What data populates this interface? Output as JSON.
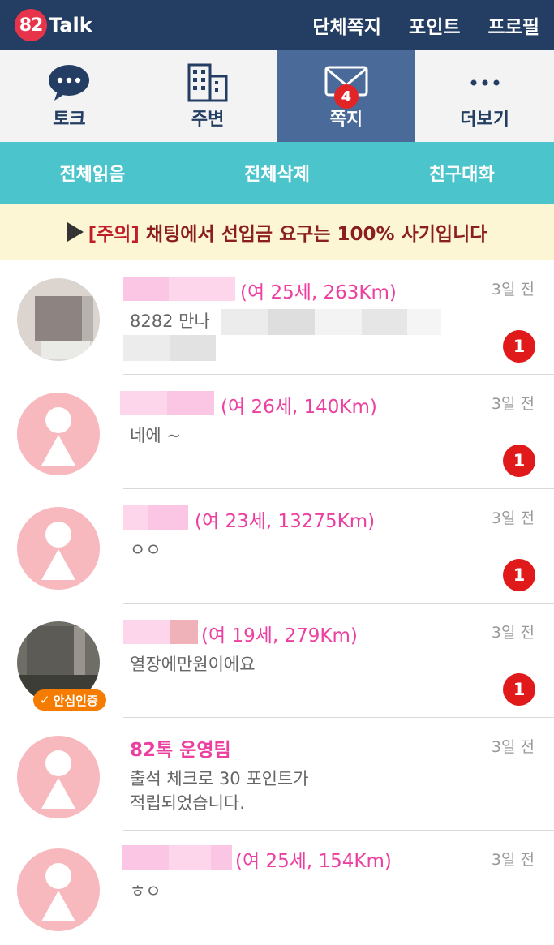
{
  "header": {
    "logo_number": "82",
    "logo_word": "Talk",
    "nav": [
      "단체쪽지",
      "포인트",
      "프로필"
    ]
  },
  "tabs": [
    {
      "label": "토크",
      "icon": "chat-bubble-icon",
      "active": false
    },
    {
      "label": "주변",
      "icon": "building-icon",
      "active": false
    },
    {
      "label": "쪽지",
      "icon": "envelope-icon",
      "active": true,
      "badge": "4"
    },
    {
      "label": "더보기",
      "icon": "more-dots-icon",
      "active": false
    }
  ],
  "actions": [
    "전체읽음",
    "전체삭제",
    "친구대화"
  ],
  "notice": {
    "warn": "[주의]",
    "text": " 채팅에서 선입금 요구는 100% 사기입니다"
  },
  "conversations": [
    {
      "info": "(여 25세, 263Km)",
      "message": "8282 만나",
      "time": "3일 전",
      "unread": "1",
      "avatar": "photo"
    },
    {
      "info": "(여 26세, 140Km)",
      "message": "네에 ~",
      "time": "3일 전",
      "unread": "1",
      "avatar": "default"
    },
    {
      "info": "(여 23세, 13275Km)",
      "message": "ㅇㅇ",
      "time": "3일 전",
      "unread": "1",
      "avatar": "default"
    },
    {
      "info": "(여 19세, 279Km)",
      "message": "열장에만원이에요",
      "time": "3일 전",
      "unread": "1",
      "avatar": "photo",
      "verified": "안심인증"
    },
    {
      "name": "82톡 운영팀",
      "message_line1": "출석 체크로 30 포인트가",
      "message_line2": "적립되었습니다.",
      "time": "3일 전",
      "avatar": "default"
    },
    {
      "info": "(여 25세, 154Km)",
      "message": "ㅎㅇ",
      "time": "3일 전",
      "avatar": "default"
    }
  ],
  "colors": {
    "header": "#243e63",
    "active_tab": "#4a6a99",
    "action_bar": "#4bc4cc",
    "notice_bg": "#fdf6d4",
    "name_pink": "#ec3fa0",
    "badge_red": "#e01a1a"
  }
}
